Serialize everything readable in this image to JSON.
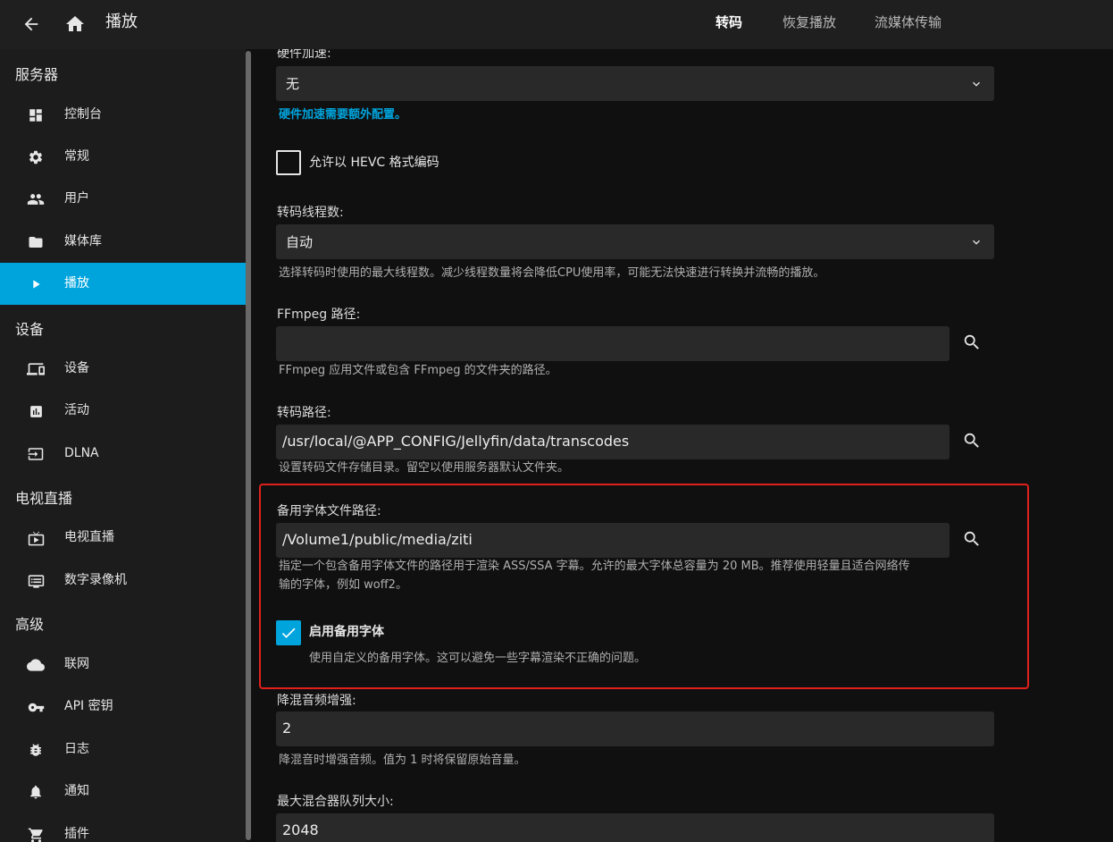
{
  "header": {
    "title": "播放",
    "tabs": [
      {
        "label": "转码",
        "active": true
      },
      {
        "label": "恢复播放",
        "active": false
      },
      {
        "label": "流媒体传输",
        "active": false
      }
    ]
  },
  "sidebar": {
    "sections": [
      {
        "title": "服务器",
        "items": [
          {
            "label": "控制台",
            "icon": "dashboard-icon"
          },
          {
            "label": "常规",
            "icon": "gear-icon"
          },
          {
            "label": "用户",
            "icon": "users-icon"
          },
          {
            "label": "媒体库",
            "icon": "folder-icon"
          },
          {
            "label": "播放",
            "icon": "play-icon",
            "active": true
          }
        ]
      },
      {
        "title": "设备",
        "items": [
          {
            "label": "设备",
            "icon": "devices-icon"
          },
          {
            "label": "活动",
            "icon": "activity-icon"
          },
          {
            "label": "DLNA",
            "icon": "input-icon"
          }
        ]
      },
      {
        "title": "电视直播",
        "items": [
          {
            "label": "电视直播",
            "icon": "live-tv-icon"
          },
          {
            "label": "数字录像机",
            "icon": "dvr-icon"
          }
        ]
      },
      {
        "title": "高级",
        "items": [
          {
            "label": "联网",
            "icon": "cloud-icon"
          },
          {
            "label": "API 密钥",
            "icon": "key-icon"
          },
          {
            "label": "日志",
            "icon": "bug-icon"
          },
          {
            "label": "通知",
            "icon": "bell-icon"
          },
          {
            "label": "插件",
            "icon": "cart-icon"
          }
        ]
      }
    ]
  },
  "content": {
    "hw_accel": {
      "label": "硬件加速:",
      "value": "无",
      "link": "硬件加速需要额外配置。"
    },
    "hevc": {
      "label": "允许以 HEVC 格式编码",
      "checked": false
    },
    "threads": {
      "label": "转码线程数:",
      "value": "自动",
      "help": "选择转码时使用的最大线程数。减少线程数量将会降低CPU使用率，可能无法快速进行转换并流畅的播放。"
    },
    "ffmpeg": {
      "label": "FFmpeg 路径:",
      "value": "",
      "help": "FFmpeg 应用文件或包含 FFmpeg 的文件夹的路径。"
    },
    "transcode_path": {
      "label": "转码路径:",
      "value": "/usr/local/@APP_CONFIG/Jellyfin/data/transcodes",
      "help": "设置转码文件存储目录。留空以使用服务器默认文件夹。"
    },
    "fallback_font": {
      "label": "备用字体文件路径:",
      "value": "/Volume1/public/media/ziti",
      "help_line1": "指定一个包含备用字体文件的路径用于渲染 ASS/SSA 字幕。允许的最大字体总容量为 20 MB。推荐使用轻量且适合网络传",
      "help_line2": "输的字体，例如 woff2。"
    },
    "enable_fallback": {
      "label": "启用备用字体",
      "checked": true,
      "help": "使用自定义的备用字体。这可以避免一些字幕渲染不正确的问题。"
    },
    "downmix": {
      "label": "降混音频增强:",
      "value": "2",
      "help": "降混音时增强音频。值为 1 时将保留原始音量。"
    },
    "muxer_queue": {
      "label": "最大混合器队列大小:",
      "value": "2048"
    }
  },
  "colors": {
    "accent": "#00a4dc",
    "highlight_box": "#e0201c"
  }
}
